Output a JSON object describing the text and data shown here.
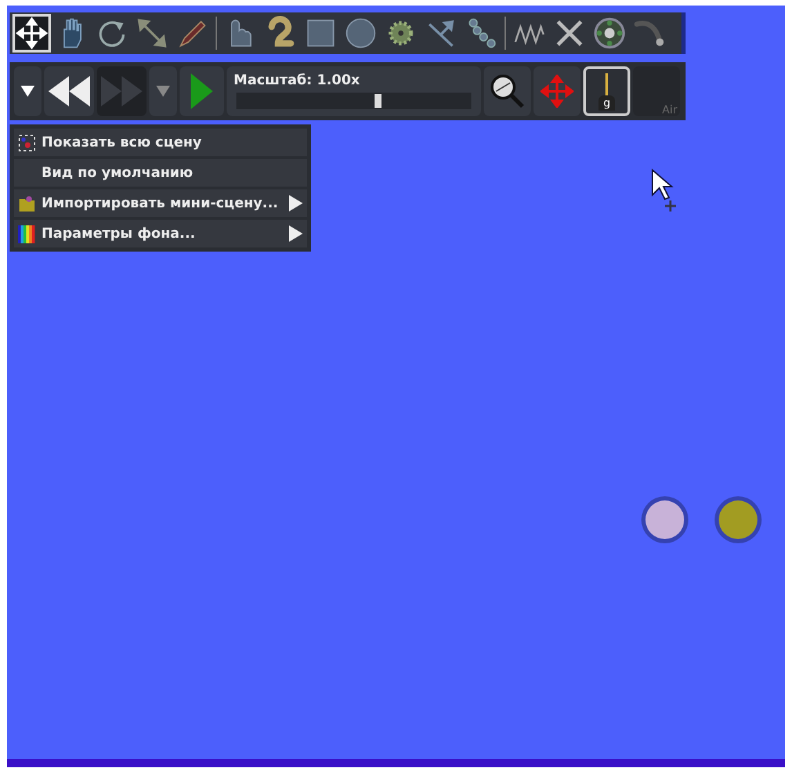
{
  "toolbar": {
    "tools": [
      {
        "kind": "move",
        "selected": true
      },
      {
        "kind": "hand",
        "selected": false
      },
      {
        "kind": "rotate",
        "selected": false
      },
      {
        "kind": "scale",
        "selected": false
      },
      {
        "kind": "knife",
        "selected": false
      },
      {
        "kind": "sep"
      },
      {
        "kind": "sketch",
        "selected": false
      },
      {
        "kind": "brush",
        "selected": false
      },
      {
        "kind": "box",
        "selected": false
      },
      {
        "kind": "circle",
        "selected": false
      },
      {
        "kind": "gear",
        "selected": false
      },
      {
        "kind": "plane",
        "selected": false
      },
      {
        "kind": "chain",
        "selected": false
      },
      {
        "kind": "sep"
      },
      {
        "kind": "spring",
        "selected": false
      },
      {
        "kind": "fixate",
        "selected": false
      },
      {
        "kind": "axle",
        "selected": false
      },
      {
        "kind": "tracer",
        "selected": false
      }
    ]
  },
  "playback": {
    "zoom_label": "Масштаб: 1.00x",
    "zoom": {
      "level": 0.6
    },
    "forward_disabled": true,
    "gravity": {
      "on": true
    },
    "air": {
      "on": false
    }
  },
  "menu": {
    "items": [
      {
        "kind": "fit",
        "label": "Показать всю сцену",
        "submenu": false
      },
      {
        "kind": "none",
        "label": "Вид по умолчанию",
        "submenu": false
      },
      {
        "kind": "folder",
        "label": "Импортировать мини-сцену...",
        "submenu": true
      },
      {
        "kind": "rainbow",
        "label": "Параметры фона...",
        "submenu": true
      }
    ]
  },
  "scene": {
    "objects": [
      {
        "color": "#c8b2d8"
      },
      {
        "color": "#a29c22"
      }
    ]
  },
  "gravity_label": "g",
  "air_label": "Air"
}
